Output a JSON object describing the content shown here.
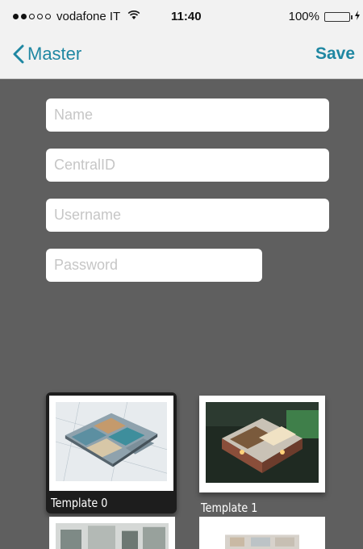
{
  "status_bar": {
    "carrier": "vodafone IT",
    "signal_filled": 2,
    "signal_total": 5,
    "wifi_icon": "wifi-icon",
    "time": "11:40",
    "battery_percent_text": "100%",
    "battery_level": 1.0,
    "battery_color": "#4cd964"
  },
  "nav": {
    "back_label": "Master",
    "save_label": "Save",
    "accent_color": "#1f87a2"
  },
  "form": {
    "name_placeholder": "Name",
    "central_id_placeholder": "CentralID",
    "username_placeholder": "Username",
    "password_placeholder": "Password"
  },
  "templates": [
    {
      "label": "Template 0",
      "selected": true
    },
    {
      "label": "Template 1",
      "selected": false
    }
  ],
  "colors": {
    "background": "#5f5f5f",
    "bar_background": "#f2f2f2"
  }
}
